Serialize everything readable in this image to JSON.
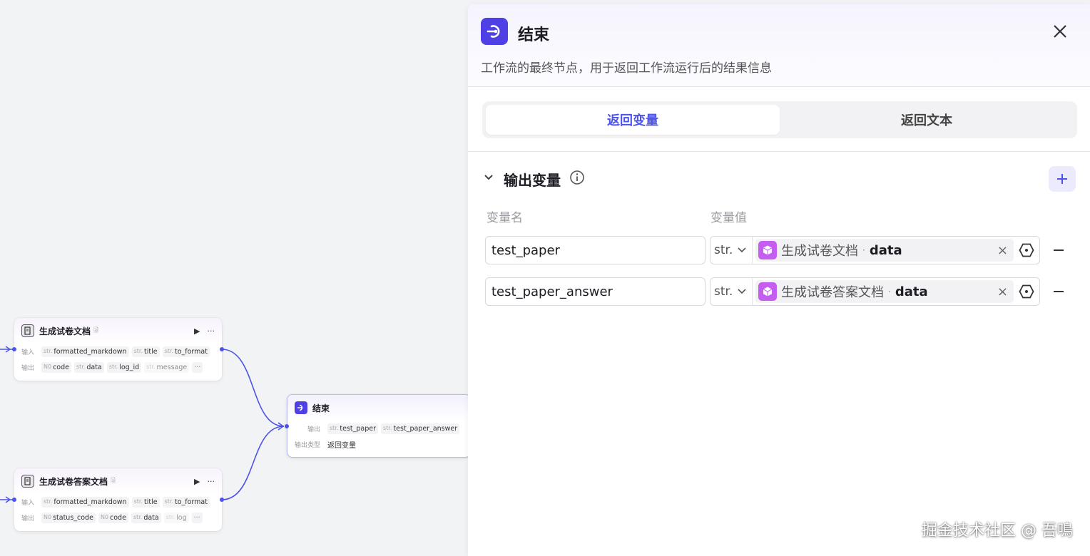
{
  "canvas": {
    "nodes": {
      "paper_doc": {
        "title": "生成试卷文档",
        "badge": "🗟",
        "input_label": "输入",
        "output_label": "输出",
        "inputs": [
          {
            "type": "str.",
            "name": "formatted_markdown"
          },
          {
            "type": "str.",
            "name": "title"
          },
          {
            "type": "str.",
            "name": "to_format"
          }
        ],
        "outputs": [
          {
            "type": "N0",
            "name": "code"
          },
          {
            "type": "str.",
            "name": "data"
          },
          {
            "type": "str.",
            "name": "log_id"
          },
          {
            "type": "str.",
            "name": "message"
          }
        ],
        "more": "···"
      },
      "answer_doc": {
        "title": "生成试卷答案文档",
        "badge": "🗟",
        "input_label": "输入",
        "output_label": "输出",
        "inputs": [
          {
            "type": "str.",
            "name": "formatted_markdown"
          },
          {
            "type": "str.",
            "name": "title"
          },
          {
            "type": "str.",
            "name": "to_format"
          }
        ],
        "outputs": [
          {
            "type": "N0",
            "name": "status_code"
          },
          {
            "type": "N0",
            "name": "code"
          },
          {
            "type": "str.",
            "name": "data"
          },
          {
            "type": "str.",
            "name": "log"
          }
        ],
        "more": "···"
      },
      "end": {
        "title": "结束",
        "output_label": "输出",
        "outputs": [
          {
            "type": "str.",
            "name": "test_paper"
          },
          {
            "type": "str.",
            "name": "test_paper_answer"
          }
        ],
        "output_type_label": "输出类型",
        "output_type_value": "返回变量"
      }
    },
    "run_glyph": "▶",
    "menu_glyph": "···"
  },
  "panel": {
    "title": "结束",
    "description": "工作流的最终节点，用于返回工作流运行后的结果信息",
    "tabs": [
      {
        "label": "返回变量",
        "active": true
      },
      {
        "label": "返回文本",
        "active": false
      }
    ],
    "section_title": "输出变量",
    "col_name": "变量名",
    "col_value": "变量值",
    "variables": [
      {
        "name": "test_paper",
        "type": "str.",
        "ref_node": "生成试卷文档",
        "ref_sep": "·",
        "ref_field": "data"
      },
      {
        "name": "test_paper_answer",
        "type": "str.",
        "ref_node": "生成试卷答案文档",
        "ref_sep": "·",
        "ref_field": "data"
      }
    ]
  },
  "watermark": "掘金技术社区 @ 吾鳴",
  "colors": {
    "accent": "#4d53e8",
    "end_icon": "#4e40e5",
    "plugin_ref": "#c55ef0"
  }
}
